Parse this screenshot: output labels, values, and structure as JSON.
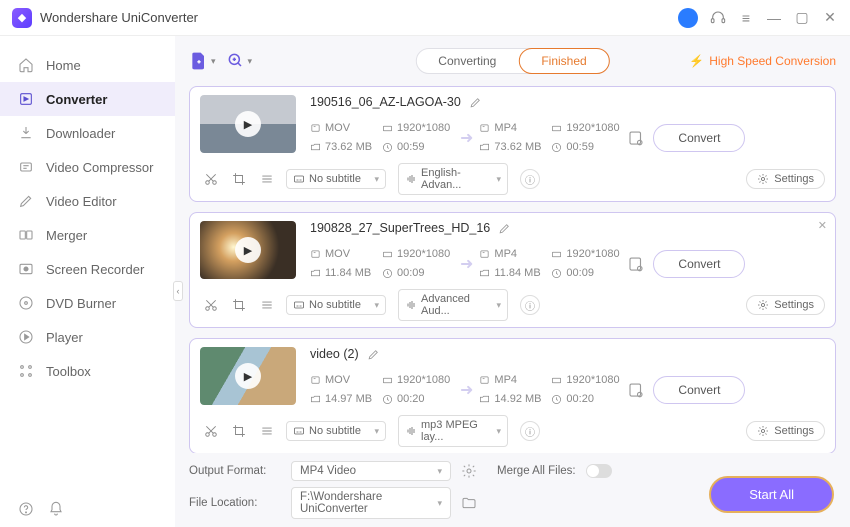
{
  "app": {
    "title": "Wondershare UniConverter"
  },
  "sidebar": {
    "items": [
      {
        "label": "Home",
        "icon": "home"
      },
      {
        "label": "Converter",
        "icon": "convert",
        "active": true
      },
      {
        "label": "Downloader",
        "icon": "download"
      },
      {
        "label": "Video Compressor",
        "icon": "compress"
      },
      {
        "label": "Video Editor",
        "icon": "edit"
      },
      {
        "label": "Merger",
        "icon": "merge"
      },
      {
        "label": "Screen Recorder",
        "icon": "record"
      },
      {
        "label": "DVD Burner",
        "icon": "dvd"
      },
      {
        "label": "Player",
        "icon": "player"
      },
      {
        "label": "Toolbox",
        "icon": "tools"
      }
    ]
  },
  "tabs": {
    "converting": "Converting",
    "finished": "Finished"
  },
  "highspeed_label": "High Speed Conversion",
  "items": [
    {
      "name": "190516_06_AZ-LAGOA-30",
      "src_fmt": "MOV",
      "src_res": "1920*1080",
      "src_size": "73.62 MB",
      "src_dur": "00:59",
      "dst_fmt": "MP4",
      "dst_res": "1920*1080",
      "dst_size": "73.62 MB",
      "dst_dur": "00:59",
      "subtitle": "No subtitle",
      "audio": "English-Advan...",
      "thumb": "dock"
    },
    {
      "name": "190828_27_SuperTrees_HD_16",
      "src_fmt": "MOV",
      "src_res": "1920*1080",
      "src_size": "11.84 MB",
      "src_dur": "00:09",
      "dst_fmt": "MP4",
      "dst_res": "1920*1080",
      "dst_size": "11.84 MB",
      "dst_dur": "00:09",
      "subtitle": "No subtitle",
      "audio": "Advanced Aud...",
      "thumb": "light",
      "closeable": true
    },
    {
      "name": "video (2)",
      "src_fmt": "MOV",
      "src_res": "1920*1080",
      "src_size": "14.97 MB",
      "src_dur": "00:20",
      "dst_fmt": "MP4",
      "dst_res": "1920*1080",
      "dst_size": "14.92 MB",
      "dst_dur": "00:20",
      "subtitle": "No subtitle",
      "audio": "mp3 MPEG lay...",
      "thumb": "aerial"
    }
  ],
  "labels": {
    "convert": "Convert",
    "settings": "Settings",
    "output_format": "Output Format:",
    "output_format_value": "MP4 Video",
    "merge_all": "Merge All Files:",
    "file_location": "File Location:",
    "file_location_value": "F:\\Wondershare UniConverter",
    "start_all": "Start All"
  }
}
